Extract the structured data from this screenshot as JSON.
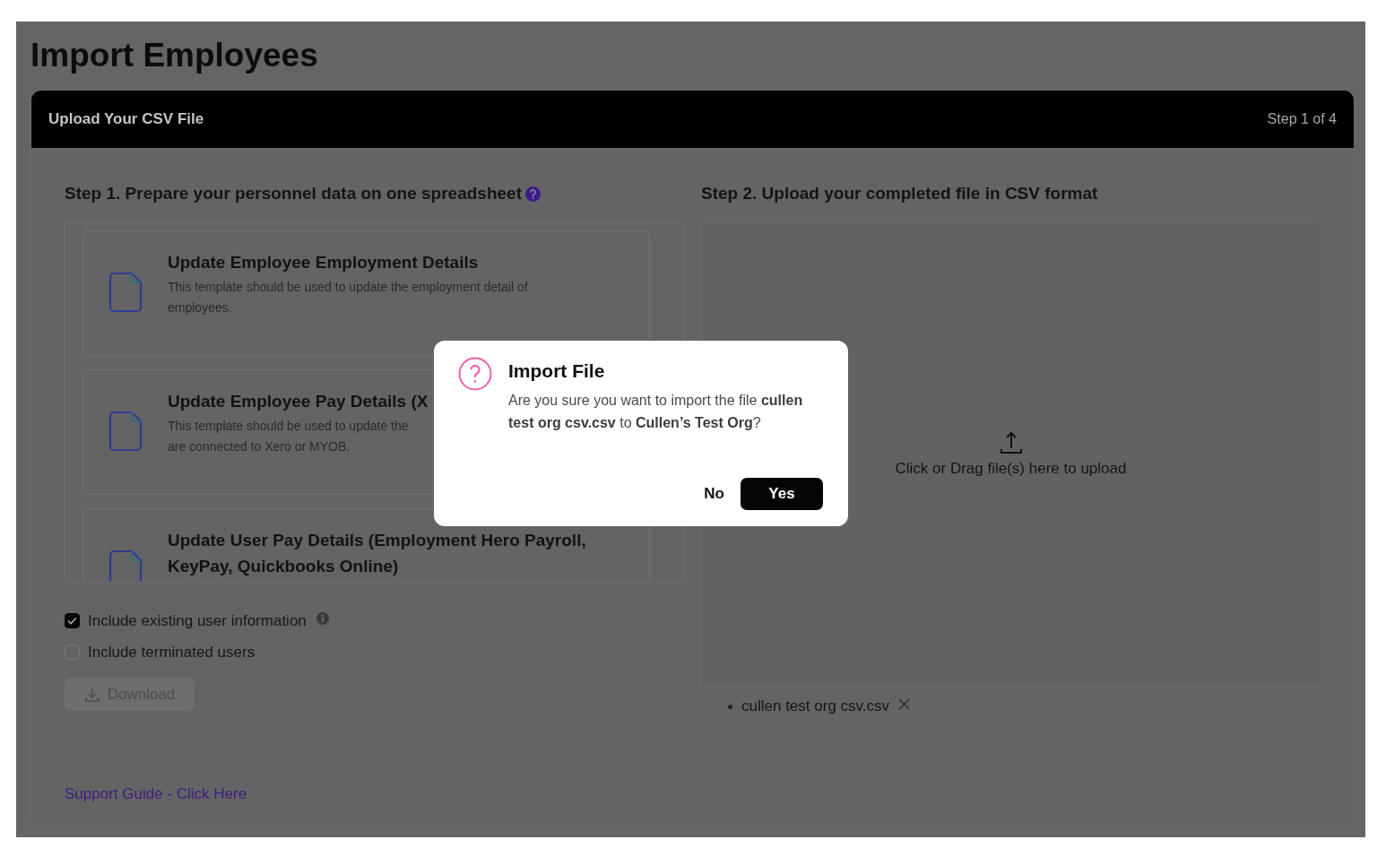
{
  "page_title": "Import Employees",
  "panel": {
    "title": "Upload Your CSV File",
    "step": "Step 1 of 4"
  },
  "step1": {
    "heading": "Step 1. Prepare your personnel data on one spreadsheet",
    "help": true,
    "templates": [
      {
        "title": [
          "Update Employee Employment Details"
        ],
        "description": [
          "This template should be used to update the employment detail of",
          "employees."
        ]
      },
      {
        "title": [
          "Update Employee Pay Details (X"
        ],
        "description": [
          "This template should be used to update the",
          "are connected to Xero or MYOB."
        ]
      },
      {
        "title": [
          "Update User Pay Details (Employment Hero Payroll,",
          "KeyPay, Quickbooks Online)"
        ]
      }
    ],
    "options": [
      {
        "label": "Include existing user information",
        "checked": true,
        "info": true
      },
      {
        "label": "Include terminated users",
        "checked": false,
        "info": false
      }
    ],
    "download_button": {
      "label": "Download",
      "disabled": true
    },
    "support_link": "Support Guide - Click Here"
  },
  "step2": {
    "heading": "Step 2. Upload your completed file in CSV format",
    "dropzone_text": "Click or Drag file(s) here to upload",
    "files": [
      {
        "name": "cullen test org csv.csv"
      }
    ]
  },
  "dialog": {
    "title": "Import File",
    "message": "Are you sure you want to import the file **cullen test org csv.csv** to **Cullen’s Test Org**?",
    "buttons": [
      {
        "label": "No",
        "kind": "secondary"
      },
      {
        "label": "Yes",
        "kind": "primary"
      }
    ]
  }
}
